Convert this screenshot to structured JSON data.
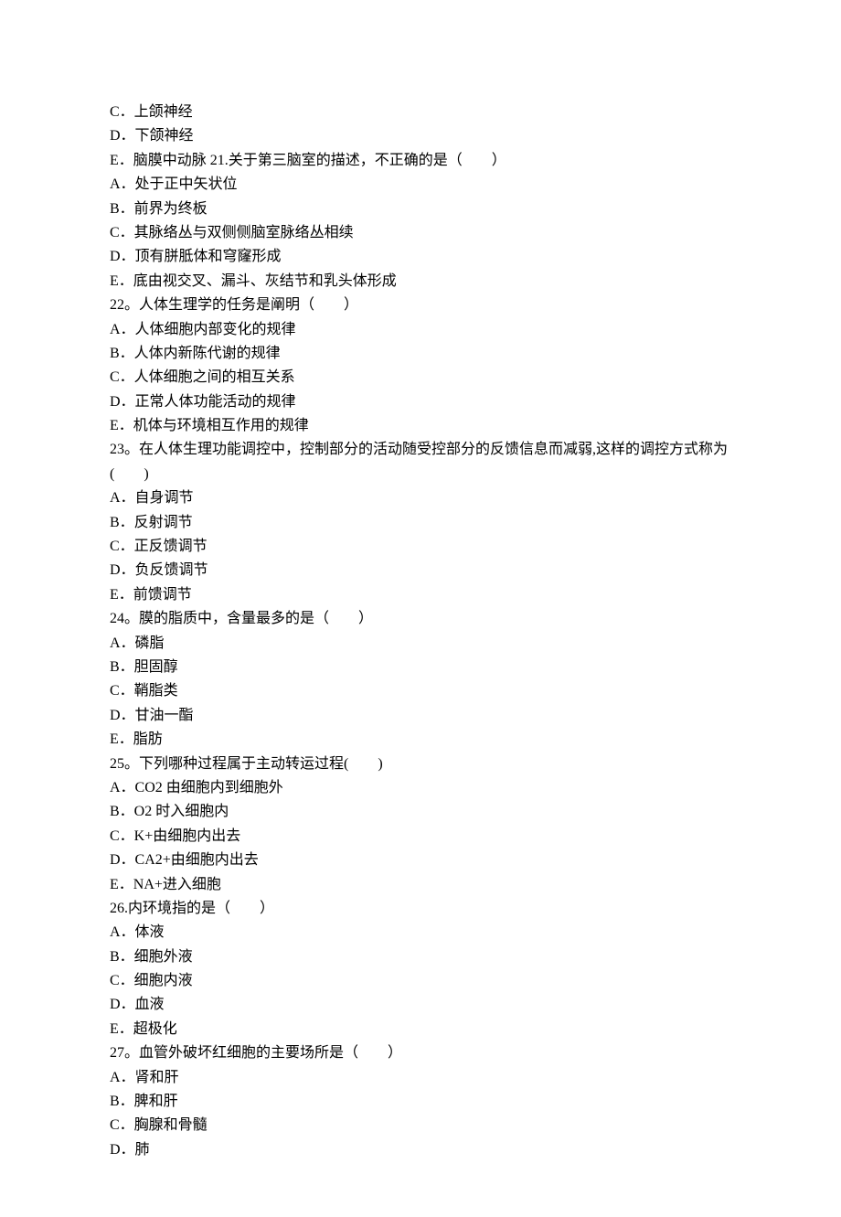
{
  "lines": [
    "C．上颌神经",
    "D．下颌神经",
    "E．脑膜中动脉 21.关于第三脑室的描述，不正确的是（　　）",
    "A．处于正中矢状位",
    "B．前界为终板",
    "C．其脉络丛与双侧侧脑室脉络丛相续",
    "D．顶有胼胝体和穹窿形成",
    "E．底由视交叉、漏斗、灰结节和乳头体形成",
    "22。人体生理学的任务是阐明（　　）",
    "A．人体细胞内部变化的规律",
    "B．人体内新陈代谢的规律",
    "C．人体细胞之间的相互关系",
    "D．正常人体功能活动的规律",
    "E．机体与环境相互作用的规律",
    "23。在人体生理功能调控中，控制部分的活动随受控部分的反馈信息而减弱,这样的调控方式称为(　　)",
    "A．自身调节",
    "B．反射调节",
    "C．正反馈调节",
    "D．负反馈调节",
    "E．前馈调节",
    "24。膜的脂质中，含量最多的是（　　）",
    "A．磷脂",
    "B．胆固醇",
    "C．鞘脂类",
    "D．甘油一酯",
    "E．脂肪",
    "25。下列哪种过程属于主动转运过程(　　)",
    "A．CO2 由细胞内到细胞外",
    "B．O2 时入细胞内",
    "C．K+由细胞内出去",
    "D．CA2+由细胞内出去",
    "E．NA+进入细胞",
    "26.内环境指的是（　　）",
    "A．体液",
    "B．细胞外液",
    "C．细胞内液",
    "D．血液",
    "E．超极化",
    "27。血管外破坏红细胞的主要场所是（　　）",
    "A．肾和肝",
    "B．脾和肝",
    "C．胸腺和骨髓",
    "D．肺"
  ]
}
